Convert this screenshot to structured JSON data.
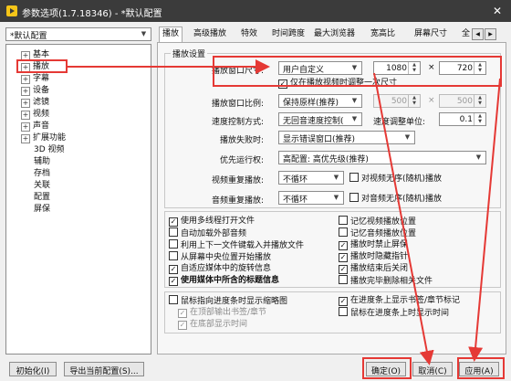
{
  "window": {
    "title": "参数选项(1.7.18346) - *默认配置",
    "close": "✕"
  },
  "profile": {
    "selected": "*默认配置"
  },
  "tree": {
    "items": [
      {
        "label": "基本",
        "expand": "+"
      },
      {
        "label": "播放",
        "expand": "+"
      },
      {
        "label": "字幕",
        "expand": "+"
      },
      {
        "label": "设备",
        "expand": "+"
      },
      {
        "label": "滤镜",
        "expand": "+"
      },
      {
        "label": "视频",
        "expand": "+"
      },
      {
        "label": "声音",
        "expand": "+"
      },
      {
        "label": "扩展功能",
        "expand": "+"
      },
      {
        "label": "3D 视频",
        "expand": ""
      },
      {
        "label": "辅助",
        "expand": ""
      },
      {
        "label": "存档",
        "expand": ""
      },
      {
        "label": "关联",
        "expand": ""
      },
      {
        "label": "配置",
        "expand": ""
      },
      {
        "label": "屏保",
        "expand": ""
      }
    ]
  },
  "tabs": [
    "播放",
    "高级播放",
    "特效",
    "时间跨度",
    "最大浏览器",
    "宽高比",
    "屏幕尺寸",
    "全"
  ],
  "tab_nav": {
    "prev": "◀",
    "next": "▶"
  },
  "panel": {
    "section_title": "播放设置",
    "window_size": {
      "label": "播放窗口尺寸:",
      "mode": "用户自定义",
      "width": "1080",
      "times": "×",
      "height": "720",
      "adjust_once": "仅在播放视频时调整一次尺寸"
    },
    "ratio": {
      "label": "播放窗口比例:",
      "value": "保持原样(推荐)",
      "w": "500",
      "times": "×",
      "h": "500"
    },
    "speed": {
      "label": "速度控制方式:",
      "value": "无回音速度控制(",
      "unit_label": "速度调整单位:",
      "unit": "0.1"
    },
    "fail": {
      "label": "播放失败时:",
      "value": "显示错误窗口(推荐)"
    },
    "priority": {
      "label": "优先运行权:",
      "value": "高配置: 高优先级(推荐)"
    },
    "video_repeat": {
      "label": "视频重复播放:",
      "value": "不循环",
      "random": "对视频无序(随机)播放"
    },
    "audio_repeat": {
      "label": "音频重复播放:",
      "value": "不循环",
      "random": "对音频无序(随机)播放"
    },
    "options_left": [
      {
        "label": "使用多线程打开文件",
        "checked": true,
        "disabled": false,
        "bold": false
      },
      {
        "label": "自动加载外部音频",
        "checked": false,
        "disabled": false,
        "bold": false
      },
      {
        "label": "利用上下一文件键载入并播放文件",
        "checked": false,
        "disabled": false,
        "bold": false
      },
      {
        "label": "从屏幕中央位置开始播放",
        "checked": false,
        "disabled": false,
        "bold": false
      },
      {
        "label": "自适应媒体中的旋转信息",
        "checked": true,
        "disabled": false,
        "bold": false
      },
      {
        "label": "使用媒体中所含的标题信息",
        "checked": true,
        "disabled": false,
        "bold": true
      }
    ],
    "options_right": [
      {
        "label": "记忆视频播放位置",
        "checked": false
      },
      {
        "label": "记忆音频播放位置",
        "checked": false
      },
      {
        "label": "播放时禁止屏保",
        "checked": true
      },
      {
        "label": "播放时隐藏指针",
        "checked": true
      },
      {
        "label": "播放结束后关闭",
        "checked": true
      },
      {
        "label": "播放完毕删除相关文件",
        "checked": false
      }
    ],
    "seek_left": [
      {
        "label": "鼠标指向进度条时显示缩略图",
        "checked": false,
        "disabled": false
      },
      {
        "label": "在顶部输出书签/章节",
        "checked": true,
        "disabled": true
      },
      {
        "label": "在底部显示时间",
        "checked": true,
        "disabled": true
      }
    ],
    "seek_right": [
      {
        "label": "在进度条上显示书签/章节标记",
        "checked": true,
        "disabled": false
      },
      {
        "label": "鼠标在进度条上时显示时间",
        "checked": false,
        "disabled": false
      }
    ]
  },
  "footer": {
    "init": "初始化(I)",
    "export": "导出当前配置(S)...",
    "ok": "确定(O)",
    "cancel": "取消(C)",
    "apply": "应用(A)"
  },
  "annotations": {
    "color": "#e53935"
  }
}
